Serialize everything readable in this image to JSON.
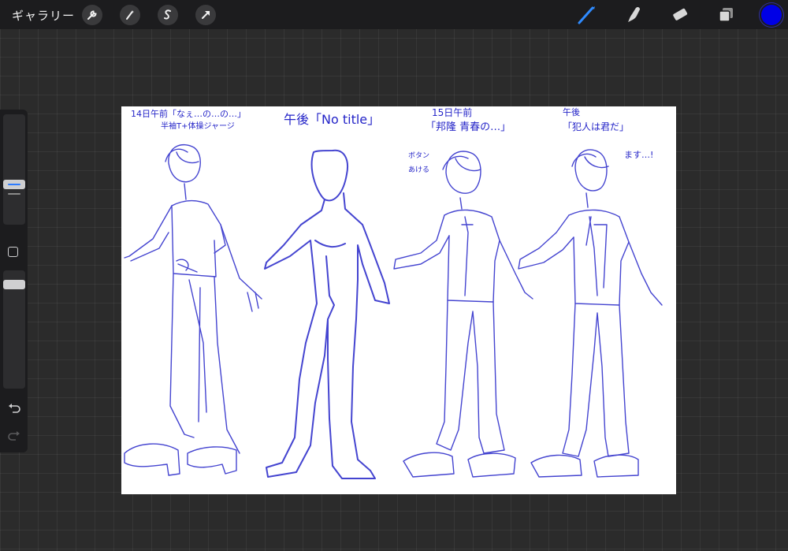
{
  "topbar": {
    "gallery_label": "ギャラリー",
    "left_tools": [
      "wrench-icon",
      "magic-wand-icon",
      "selection-icon",
      "transform-arrow-icon"
    ],
    "right_tools": [
      "brush-icon",
      "smudge-icon",
      "eraser-icon",
      "layers-icon"
    ],
    "current_color": "#0000e6"
  },
  "sidebar": {
    "controls": [
      "brush-size-slider",
      "modify-square-button",
      "opacity-slider",
      "undo-icon",
      "redo-icon"
    ]
  },
  "canvas": {
    "stroke_color": "#2424c8",
    "notes": {
      "n1_line1": "14日午前「なぇ…の…の…」",
      "n1_line2": "半袖T+体操ジャージ",
      "n2": "午後「No title」",
      "n3_line1": "15日午前",
      "n3_line2": "「邦隆 青春の…」",
      "n3_side_1": "ボタン",
      "n3_side_2": "あける",
      "n4_line1": "午後",
      "n4_line2": "「犯人は君だ」",
      "n4_side": "ます…!"
    }
  }
}
